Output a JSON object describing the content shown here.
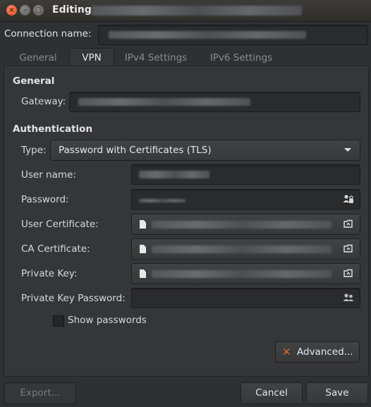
{
  "window": {
    "title": "Editing"
  },
  "connection": {
    "label": "Connection name:"
  },
  "tabs": [
    {
      "label": "General"
    },
    {
      "label": "VPN"
    },
    {
      "label": "IPv4 Settings"
    },
    {
      "label": "IPv6 Settings"
    }
  ],
  "general": {
    "heading": "General",
    "gateway_label": "Gateway:"
  },
  "auth": {
    "heading": "Authentication",
    "type_label": "Type:",
    "type_value": "Password with Certificates (TLS)",
    "username_label": "User name:",
    "password_label": "Password:",
    "user_cert_label": "User Certificate:",
    "ca_cert_label": "CA Certificate:",
    "private_key_label": "Private Key:",
    "private_key_password_label": "Private Key Password:",
    "show_passwords_label": "Show passwords"
  },
  "buttons": {
    "advanced": "Advanced...",
    "export": "Export...",
    "cancel": "Cancel",
    "save": "Save"
  },
  "icons": {
    "close": "close-icon",
    "minimize": "minimize-icon",
    "maximize": "maximize-icon",
    "user_group": "user-group-icon",
    "file": "file-icon",
    "open_folder": "open-folder-icon",
    "tools": "tools-icon",
    "dropdown": "dropdown-arrow-icon"
  }
}
